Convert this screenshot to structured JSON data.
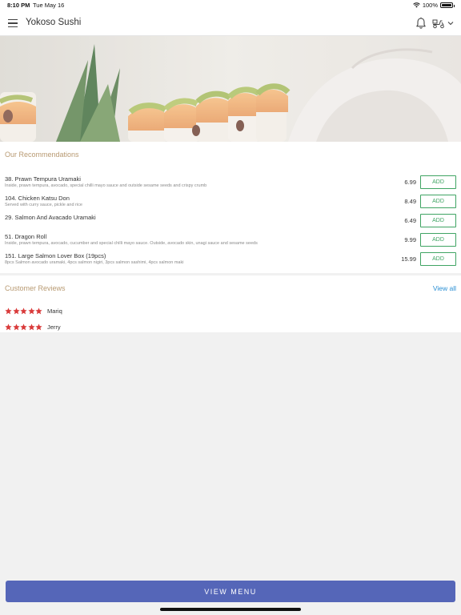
{
  "status_bar": {
    "time": "8:10 PM",
    "date": "Tue May 16",
    "battery": "100%",
    "icons": [
      "wifi-icon",
      "battery-icon"
    ]
  },
  "header": {
    "title": "Yokoso Sushi",
    "icons": [
      "hamburger-menu-icon",
      "bell-icon",
      "delivery-scooter-icon",
      "chevron-down-icon"
    ]
  },
  "hero": {
    "icon": "sushi-hero-image"
  },
  "recommendations": {
    "title": "Our Recommendations",
    "add_label": "ADD",
    "items": [
      {
        "name": "38. Prawn Tempura Uramaki",
        "description": "Inside, prawn tempura, avocado, special chilli mayo sauce and outside sesame seeds and crispy crumb",
        "price": "6.99"
      },
      {
        "name": "104. Chicken Katsu Don",
        "description": "Served with curry sauce, pickle and rice",
        "price": "8.49"
      },
      {
        "name": "29. Salmon And Avacado Uramaki",
        "description": "",
        "price": "6.49"
      },
      {
        "name": "51. Dragon Roll",
        "description": "Inside, prawn tempura, avocado, cucumber and special chilli mayo sauce. Outside, avocado skin, unagi sauce and sesame seeds",
        "price": "9.99"
      },
      {
        "name": "151. Large Salmon Lover Box (19pcs)",
        "description": "8pcs Salmon avocado uramaki, 4pcs salmon nigiri, 3pcs salmon sashimi, 4pcs salmon maki",
        "price": "15.99"
      }
    ]
  },
  "reviews": {
    "title": "Customer Reviews",
    "view_all": "View all",
    "items": [
      {
        "name": "Mariq",
        "rating": 5
      },
      {
        "name": "Jerry",
        "rating": 5
      }
    ]
  },
  "footer": {
    "view_menu": "VIEW MENU"
  },
  "colors": {
    "accent_text": "#b89a72",
    "add_button": "#3fa463",
    "link": "#2a8fd4",
    "primary_button": "#5566b8",
    "star": "#d93a3a"
  }
}
